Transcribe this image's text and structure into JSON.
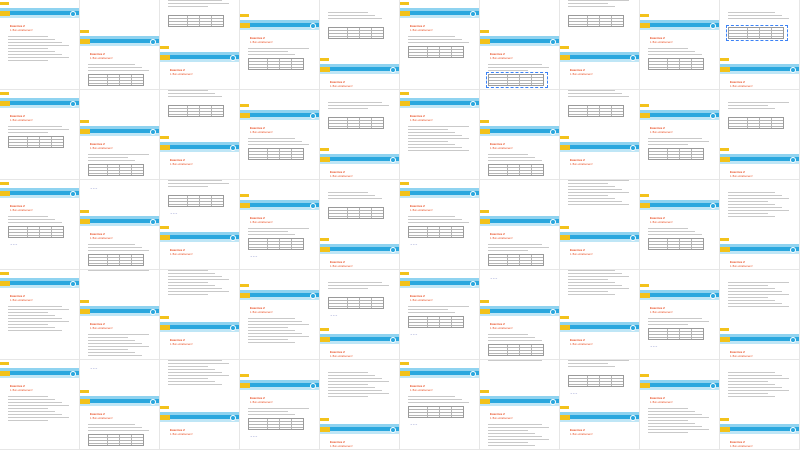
{
  "worksheet": {
    "exercise_title": "Exercice 2",
    "section_heading": "1. Bon entraînement !",
    "columns": 10,
    "rows": 5,
    "colors": {
      "header_light": "#8fd3f0",
      "header_main": "#2aa7de",
      "accent_yellow": "#f3c21b",
      "title_red": "#e8491d",
      "handwriting": "#2b3aa0",
      "selection": "#3b82f6"
    }
  },
  "pages": [
    {
      "variant": "text"
    },
    {
      "variant": "table"
    },
    {
      "variant": "table"
    },
    {
      "variant": "table"
    },
    {
      "variant": "table"
    },
    {
      "variant": "table"
    },
    {
      "variant": "table-selected"
    },
    {
      "variant": "table"
    },
    {
      "variant": "table"
    },
    {
      "variant": "table-selected"
    },
    {
      "variant": "table"
    },
    {
      "variant": "table"
    },
    {
      "variant": "table"
    },
    {
      "variant": "table"
    },
    {
      "variant": "table"
    },
    {
      "variant": "text"
    },
    {
      "variant": "table"
    },
    {
      "variant": "table"
    },
    {
      "variant": "table"
    },
    {
      "variant": "table"
    },
    {
      "variant": "table-hand"
    },
    {
      "variant": "table-hand"
    },
    {
      "variant": "table-hand"
    },
    {
      "variant": "table-hand"
    },
    {
      "variant": "table"
    },
    {
      "variant": "table-hand"
    },
    {
      "variant": "table"
    },
    {
      "variant": "text"
    },
    {
      "variant": "table"
    },
    {
      "variant": "text"
    },
    {
      "variant": "text"
    },
    {
      "variant": "text"
    },
    {
      "variant": "text"
    },
    {
      "variant": "text"
    },
    {
      "variant": "table-hand"
    },
    {
      "variant": "table-hand"
    },
    {
      "variant": "table-hand"
    },
    {
      "variant": "text"
    },
    {
      "variant": "table-hand"
    },
    {
      "variant": "text"
    },
    {
      "variant": "text"
    },
    {
      "variant": "table-hand"
    },
    {
      "variant": "text"
    },
    {
      "variant": "table-hand"
    },
    {
      "variant": "text"
    },
    {
      "variant": "table-hand"
    },
    {
      "variant": "text"
    },
    {
      "variant": "table-hand"
    },
    {
      "variant": "text"
    },
    {
      "variant": "text"
    }
  ]
}
